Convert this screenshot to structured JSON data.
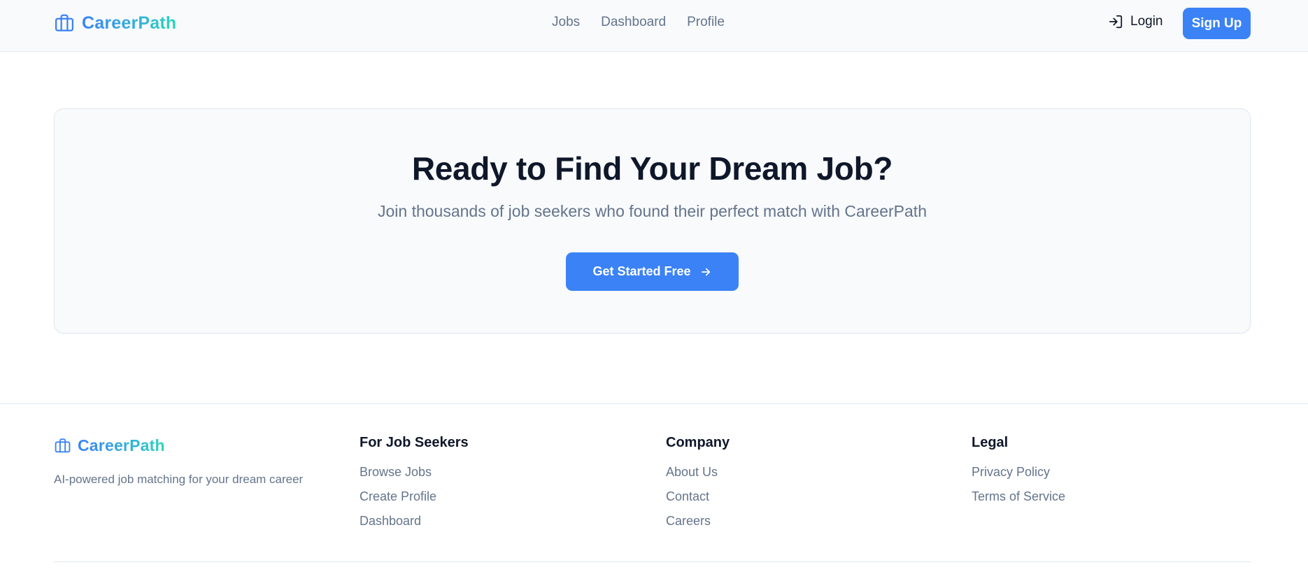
{
  "brand": {
    "name": "CareerPath",
    "icon": "briefcase-icon"
  },
  "nav": {
    "links": [
      "Jobs",
      "Dashboard",
      "Profile"
    ],
    "login_label": "Login",
    "login_icon": "login-icon",
    "signup_label": "Sign Up"
  },
  "hero": {
    "title": "Ready to Find Your Dream Job?",
    "subtitle": "Join thousands of job seekers who found their perfect match with CareerPath",
    "cta_label": "Get Started Free",
    "cta_icon": "arrow-right-icon"
  },
  "footer": {
    "brand_name": "CareerPath",
    "tagline": "AI-powered job matching for your dream career",
    "columns": [
      {
        "title": "For Job Seekers",
        "links": [
          "Browse Jobs",
          "Create Profile",
          "Dashboard"
        ]
      },
      {
        "title": "Company",
        "links": [
          "About Us",
          "Contact",
          "Careers"
        ]
      },
      {
        "title": "Legal",
        "links": [
          "Privacy Policy",
          "Terms of Service"
        ]
      }
    ]
  },
  "colors": {
    "primary": "#3b82f6",
    "accent": "#2dd4bf",
    "text_dark": "#0f172a",
    "text_muted": "#64748b",
    "border": "#e2e8f0"
  }
}
